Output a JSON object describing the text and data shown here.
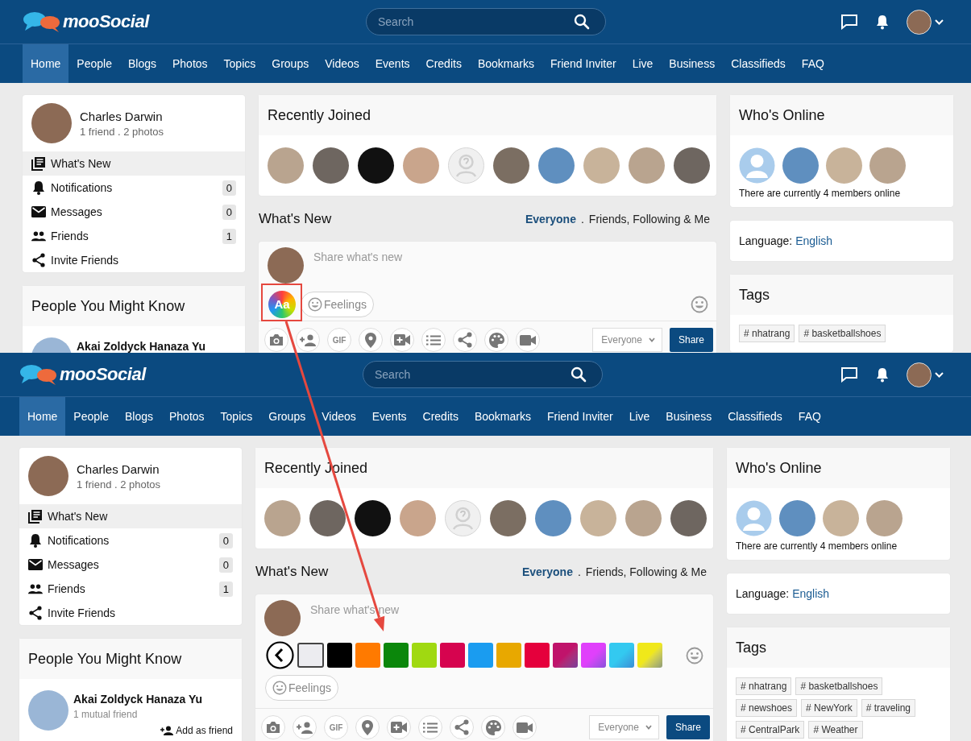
{
  "screens": [
    {
      "header": {
        "logo": "mooSocial",
        "search_placeholder": "Search"
      },
      "nav": [
        {
          "label": "Home",
          "selected": true
        },
        {
          "label": "People",
          "selected": false
        },
        {
          "label": "Blogs",
          "selected": false
        },
        {
          "label": "Photos",
          "selected": false
        },
        {
          "label": "Topics",
          "selected": false
        },
        {
          "label": "Groups",
          "selected": false
        },
        {
          "label": "Videos",
          "selected": false
        },
        {
          "label": "Events",
          "selected": false
        },
        {
          "label": "Credits",
          "selected": false
        },
        {
          "label": "Bookmarks",
          "selected": false
        },
        {
          "label": "Friend Inviter",
          "selected": false
        },
        {
          "label": "Live",
          "selected": false
        },
        {
          "label": "Business",
          "selected": false
        },
        {
          "label": "Classifieds",
          "selected": false
        },
        {
          "label": "FAQ",
          "selected": false
        }
      ],
      "profile": {
        "name": "Charles Darwin",
        "stats": "1 friend . 2 photos"
      },
      "menu": [
        {
          "label": "What's New",
          "selected": true
        },
        {
          "label": "Notifications",
          "count": "0",
          "selected": false
        },
        {
          "label": "Messages",
          "count": "0",
          "selected": false
        },
        {
          "label": "Friends",
          "count": "1",
          "selected": false
        },
        {
          "label": "Invite Friends",
          "selected": false
        }
      ],
      "people": {
        "title": "People You Might Know",
        "items": [
          {
            "name": "Akai Zoldyck Hanaza Yu"
          }
        ]
      },
      "recently_joined": {
        "title": "Recently Joined",
        "avatars": [
          {
            "kind": "photo"
          },
          {
            "kind": "photo"
          },
          {
            "kind": "photo"
          },
          {
            "kind": "photo"
          },
          {
            "kind": "default"
          },
          {
            "kind": "photo"
          },
          {
            "kind": "photo"
          },
          {
            "kind": "photo"
          },
          {
            "kind": "photo"
          },
          {
            "kind": "photo"
          }
        ]
      },
      "feed": {
        "title": "What's New",
        "separator": ".",
        "filters": [
          {
            "label": "Everyone",
            "selected": true
          },
          {
            "label": "Friends, Following & Me",
            "selected": false
          }
        ]
      },
      "composer": {
        "placeholder": "Share what's new",
        "style_button": "Aa",
        "feelings": "Feelings",
        "privacy": "Everyone",
        "share": "Share",
        "tools": [
          {
            "kind": "camera"
          },
          {
            "kind": "tag-friend"
          },
          {
            "kind": "gif",
            "label": "GIF"
          },
          {
            "kind": "location"
          },
          {
            "kind": "video-add"
          },
          {
            "kind": "list"
          },
          {
            "kind": "share"
          },
          {
            "kind": "palette"
          },
          {
            "kind": "video"
          }
        ]
      },
      "online": {
        "title": "Who's Online",
        "avatars": [
          {
            "kind": "user"
          },
          {
            "kind": "photo"
          },
          {
            "kind": "photo"
          },
          {
            "kind": "photo"
          }
        ],
        "text": "There are currently 4 members online"
      },
      "language": {
        "label": "Language:",
        "value": "English"
      },
      "tags": {
        "title": "Tags",
        "items": [
          "# nhatrang",
          "# basketballshoes"
        ]
      }
    },
    {
      "header": {
        "logo": "mooSocial",
        "search_placeholder": "Search"
      },
      "nav": [
        {
          "label": "Home",
          "selected": true
        },
        {
          "label": "People",
          "selected": false
        },
        {
          "label": "Blogs",
          "selected": false
        },
        {
          "label": "Photos",
          "selected": false
        },
        {
          "label": "Topics",
          "selected": false
        },
        {
          "label": "Groups",
          "selected": false
        },
        {
          "label": "Videos",
          "selected": false
        },
        {
          "label": "Events",
          "selected": false
        },
        {
          "label": "Credits",
          "selected": false
        },
        {
          "label": "Bookmarks",
          "selected": false
        },
        {
          "label": "Friend Inviter",
          "selected": false
        },
        {
          "label": "Live",
          "selected": false
        },
        {
          "label": "Business",
          "selected": false
        },
        {
          "label": "Classifieds",
          "selected": false
        },
        {
          "label": "FAQ",
          "selected": false
        }
      ],
      "profile": {
        "name": "Charles Darwin",
        "stats": "1 friend . 2 photos"
      },
      "menu": [
        {
          "label": "What's New",
          "selected": true
        },
        {
          "label": "Notifications",
          "count": "0",
          "selected": false
        },
        {
          "label": "Messages",
          "count": "0",
          "selected": false
        },
        {
          "label": "Friends",
          "count": "1",
          "selected": false
        },
        {
          "label": "Invite Friends",
          "selected": false
        }
      ],
      "people": {
        "title": "People You Might Know",
        "items": [
          {
            "name": "Akai Zoldyck Hanaza Yu",
            "mutual": "1 mutual friend",
            "action": "Add as friend"
          }
        ]
      },
      "recently_joined": {
        "title": "Recently Joined",
        "avatars": [
          {
            "kind": "photo"
          },
          {
            "kind": "photo"
          },
          {
            "kind": "photo"
          },
          {
            "kind": "photo"
          },
          {
            "kind": "default"
          },
          {
            "kind": "photo"
          },
          {
            "kind": "photo"
          },
          {
            "kind": "photo"
          },
          {
            "kind": "photo"
          },
          {
            "kind": "photo"
          }
        ]
      },
      "feed": {
        "title": "What's New",
        "separator": ".",
        "filters": [
          {
            "label": "Everyone",
            "selected": true
          },
          {
            "label": "Friends, Following & Me",
            "selected": false
          }
        ]
      },
      "composer": {
        "placeholder": "Share what's new",
        "feelings": "Feelings",
        "privacy": "Everyone",
        "share": "Share",
        "palette": [
          {
            "kind": "solid",
            "color": "#ececf0",
            "selected": true
          },
          {
            "kind": "solid",
            "color": "#000000",
            "selected": false
          },
          {
            "kind": "solid",
            "color": "#ff7a00",
            "selected": false
          },
          {
            "kind": "solid",
            "color": "#0b870b",
            "selected": false
          },
          {
            "kind": "solid",
            "color": "#a0d911",
            "selected": false
          },
          {
            "kind": "solid",
            "color": "#d6044f",
            "selected": false
          },
          {
            "kind": "solid",
            "color": "#1a9cf0",
            "selected": false
          },
          {
            "kind": "solid",
            "color": "#e8a800",
            "selected": false
          },
          {
            "kind": "solid",
            "color": "#e5003c",
            "selected": false
          },
          {
            "kind": "gradient",
            "color": "#c0136b",
            "selected": false
          },
          {
            "kind": "gradient",
            "color": "#e040fb",
            "selected": false
          },
          {
            "kind": "gradient",
            "color": "#33c9f0",
            "selected": false
          },
          {
            "kind": "gradient",
            "color": "#f0e81a",
            "selected": false
          }
        ],
        "tools": [
          {
            "kind": "camera"
          },
          {
            "kind": "tag-friend"
          },
          {
            "kind": "gif",
            "label": "GIF"
          },
          {
            "kind": "location"
          },
          {
            "kind": "video-add"
          },
          {
            "kind": "list"
          },
          {
            "kind": "share"
          },
          {
            "kind": "palette"
          },
          {
            "kind": "video"
          }
        ]
      },
      "online": {
        "title": "Who's Online",
        "avatars": [
          {
            "kind": "user"
          },
          {
            "kind": "photo"
          },
          {
            "kind": "photo"
          },
          {
            "kind": "photo"
          }
        ],
        "text": "There are currently 4 members online"
      },
      "language": {
        "label": "Language:",
        "value": "English"
      },
      "tags": {
        "title": "Tags",
        "items": [
          "# nhatrang",
          "# basketballshoes",
          "# newshoes",
          "# NewYork",
          "# traveling",
          "# CentralPark",
          "# Weather"
        ]
      }
    }
  ]
}
